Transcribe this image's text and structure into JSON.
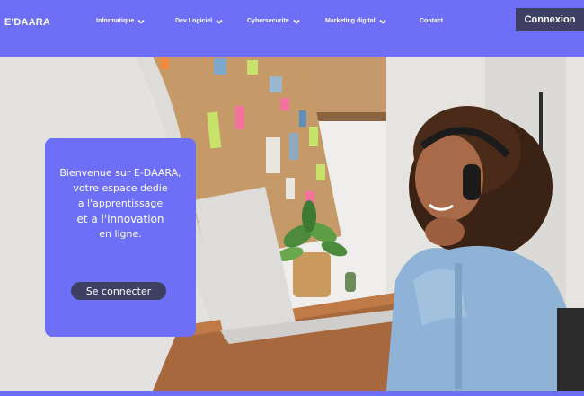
{
  "brand": {
    "logo": "E'DAARA"
  },
  "nav": {
    "items": [
      {
        "label": "Informatique",
        "has_dropdown": true
      },
      {
        "label": "Dev Logiciel",
        "has_dropdown": true
      },
      {
        "label": "Cybersecurite",
        "has_dropdown": true
      },
      {
        "label": "Marketing digital",
        "has_dropdown": true
      },
      {
        "label": "Contact",
        "has_dropdown": false
      }
    ],
    "login_label": "Connexion"
  },
  "hero": {
    "welcome_lines": [
      "Bienvenue sur E-DAARA,",
      "votre espace dedie",
      "a l'apprentissage",
      "et a l'innovation",
      "en ligne."
    ],
    "signin_label": "Se connecter"
  },
  "colors": {
    "brand": "#6d6ff7",
    "button_dark": "#3e4063"
  },
  "icons": {
    "chevron": "chevron-down-icon"
  }
}
